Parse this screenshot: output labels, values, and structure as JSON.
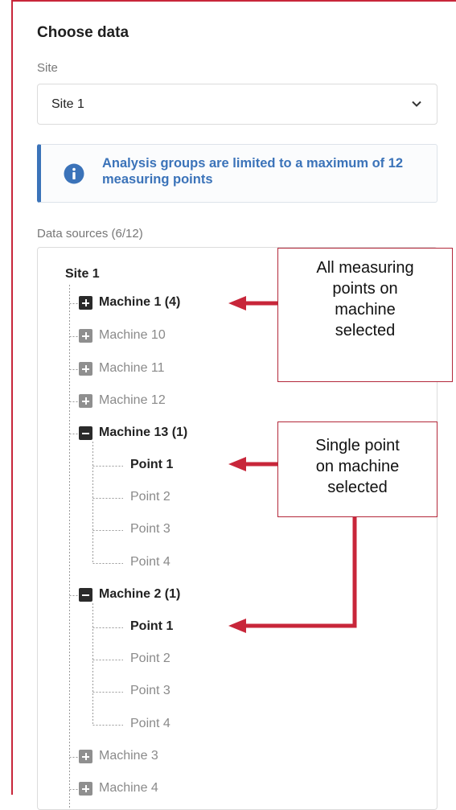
{
  "panel": {
    "title": "Choose data",
    "site_label": "Site",
    "site_select": {
      "value": "Site 1",
      "icon": "chevron-down-icon"
    },
    "info": {
      "icon": "info-circle-icon",
      "text": "Analysis groups are limited to a maximum of 12 measuring points"
    },
    "data_sources_label": "Data sources (6/12)"
  },
  "tree": {
    "root": "Site 1",
    "m1": "Machine 1 (4)",
    "m10": "Machine 10",
    "m11": "Machine 11",
    "m12": "Machine 12",
    "m13": "Machine 13 (1)",
    "m13_points": [
      "Point 1",
      "Point 2",
      "Point 3",
      "Point 4"
    ],
    "m2": "Machine 2 (1)",
    "m2_points": [
      "Point 1",
      "Point 2",
      "Point 3",
      "Point 4"
    ],
    "m3": "Machine 3",
    "m4": "Machine 4"
  },
  "callouts": {
    "machine": [
      "All measuring",
      "points on",
      "machine",
      "selected"
    ],
    "point": [
      "Single point",
      "on machine",
      "selected"
    ]
  },
  "colors": {
    "accent": "#3b73b9",
    "annotation": "#c8263a",
    "selected_text": "#222222",
    "unselected_text": "#8a8a8a"
  }
}
